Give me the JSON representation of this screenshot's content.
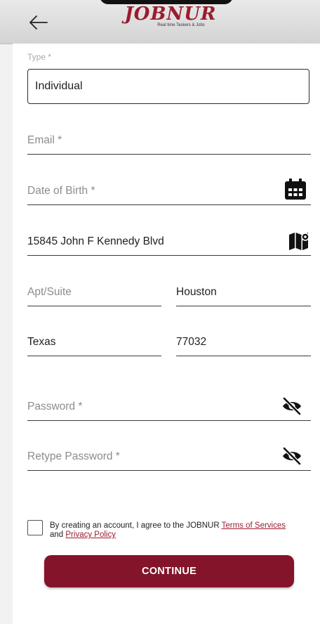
{
  "header": {
    "back_icon": "arrow-left-icon",
    "logo_text": "JOBNUR",
    "logo_tagline": "Real time Taskers & Jobs",
    "brand_color": "#9b1c2e"
  },
  "form": {
    "type": {
      "label": "Type *",
      "value": "Individual"
    },
    "email": {
      "placeholder": "Email *",
      "value": ""
    },
    "dob": {
      "placeholder": "Date of Birth *",
      "value": "",
      "icon": "calendar-icon"
    },
    "address": {
      "value": "15845 John F Kennedy Blvd",
      "icon": "map-icon"
    },
    "apt": {
      "placeholder": "Apt/Suite",
      "value": ""
    },
    "city": {
      "value": "Houston"
    },
    "state": {
      "value": "Texas"
    },
    "zip": {
      "value": "77032"
    },
    "password": {
      "placeholder": "Password *",
      "value": "",
      "icon": "eye-slash-icon"
    },
    "retype_password": {
      "placeholder": "Retype Password *",
      "value": "",
      "icon": "eye-slash-icon"
    }
  },
  "terms": {
    "checked": false,
    "text_before": "By creating an account, I agree to the JOBNUR ",
    "terms_link": "Terms of Services",
    "and_text": "and ",
    "privacy_link": "Privacy Policy"
  },
  "actions": {
    "continue_label": "CONTINUE",
    "button_color": "#84142a"
  }
}
